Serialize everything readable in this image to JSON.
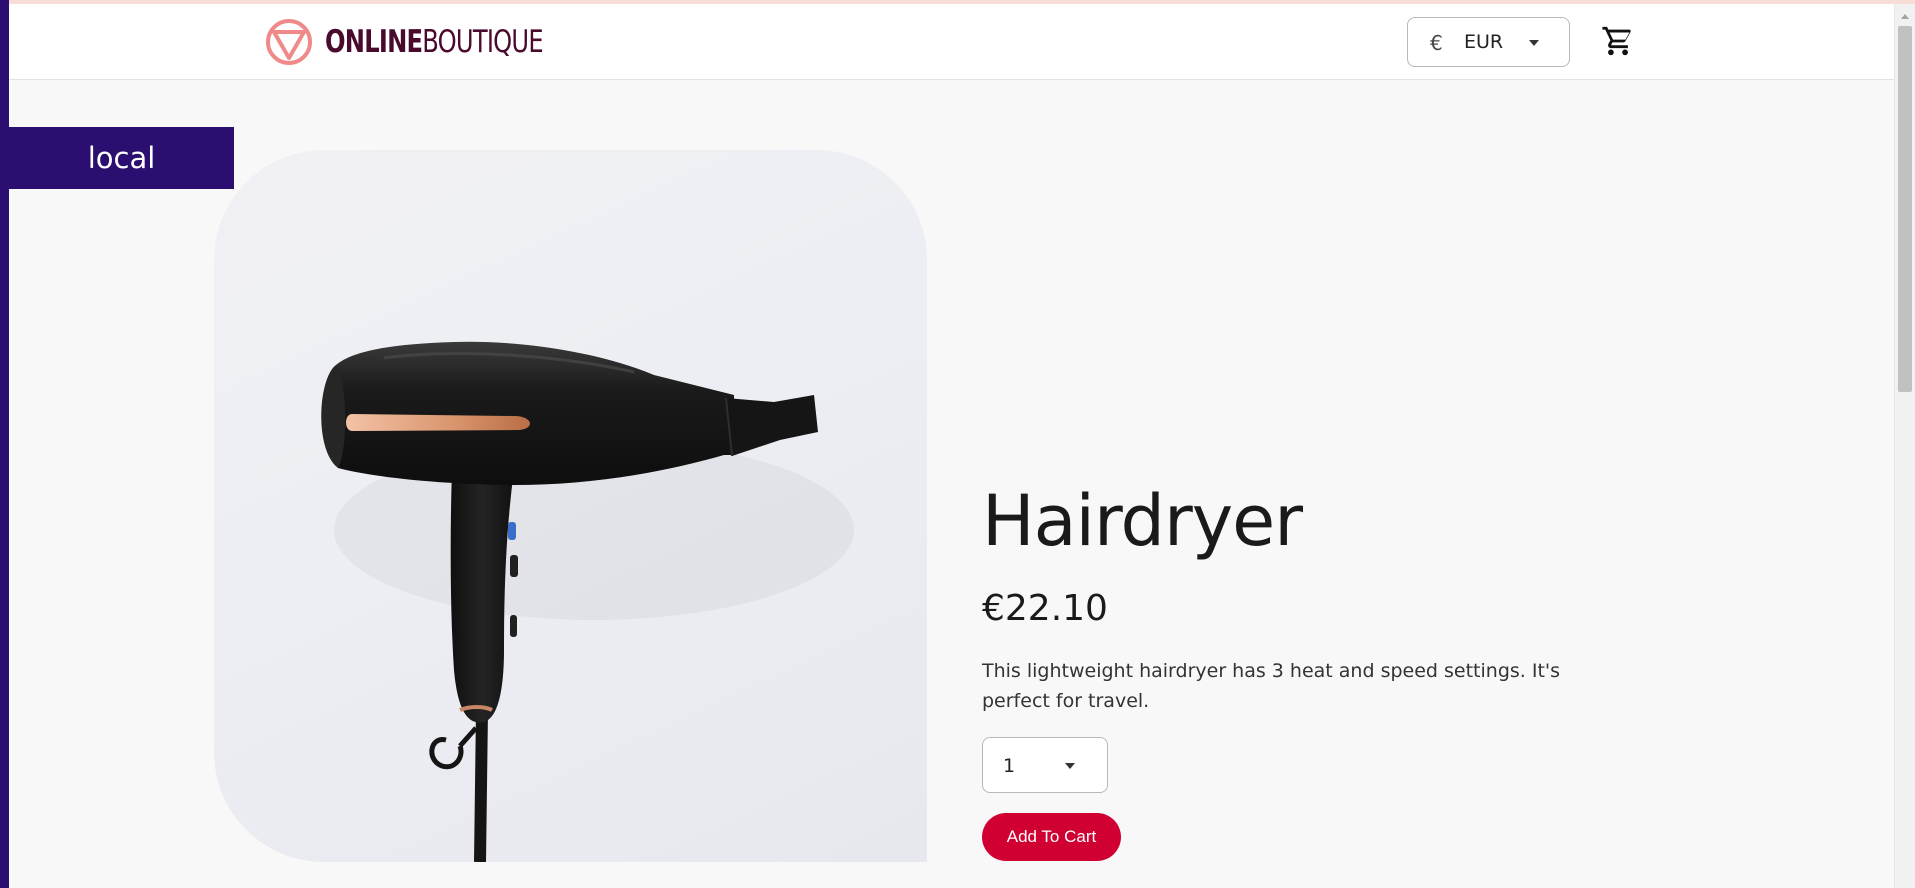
{
  "header": {
    "logo": {
      "bold": "ONLINE",
      "light": "BOUTIQUE"
    },
    "currency": {
      "symbol": "€",
      "code": "EUR"
    },
    "cart_icon": "cart-icon"
  },
  "environment_badge": "local",
  "product": {
    "name": "Hairdryer",
    "price": "€22.10",
    "description": "This lightweight hairdryer has 3 heat and speed settings. It's perfect for travel.",
    "quantity": "1",
    "add_to_cart_label": "Add To Cart"
  },
  "colors": {
    "brand_dark": "#4a0a2e",
    "logo_accent": "#f08a8a",
    "env_badge": "#2a0f70",
    "cta": "#d10032"
  }
}
